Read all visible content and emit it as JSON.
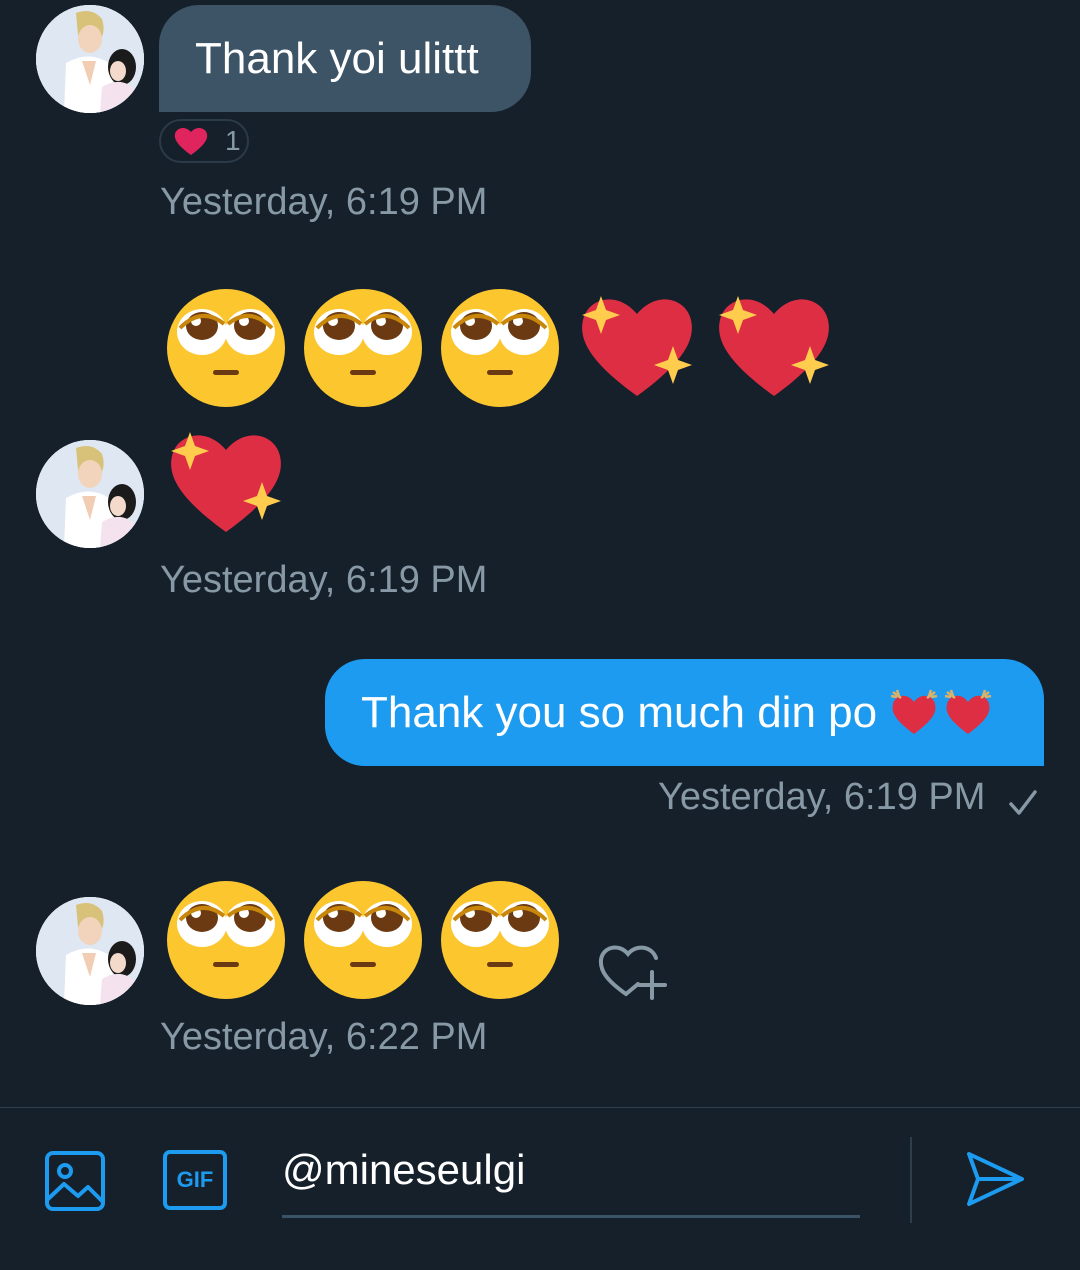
{
  "messages": [
    {
      "text": "Thank yoi ulittt",
      "reaction": {
        "icon": "heart",
        "count": "1"
      },
      "timestamp": "Yesterday, 6:19 PM"
    },
    {
      "emojis": [
        "pleading-face",
        "pleading-face",
        "pleading-face",
        "sparkling-heart",
        "sparkling-heart",
        "sparkling-heart"
      ],
      "timestamp": "Yesterday, 6:19 PM"
    },
    {
      "text": "Thank you so much din po",
      "emojis": [
        "heart-with-arrows",
        "heart-with-arrows"
      ],
      "timestamp": "Yesterday, 6:19 PM",
      "status": "sent-check"
    },
    {
      "emojis": [
        "pleading-face",
        "pleading-face",
        "pleading-face"
      ],
      "timestamp": "Yesterday, 6:22 PM"
    }
  ],
  "composer": {
    "input_value": "@mineseulgi",
    "gif_label": "GIF",
    "icons": [
      "image-icon",
      "gif-icon",
      "send-icon"
    ]
  },
  "colors": {
    "background": "#15202b",
    "incoming_bubble": "#3d5466",
    "outgoing_bubble": "#1d9bf0",
    "timestamp": "#8899a6",
    "accent": "#1d9bf0"
  }
}
